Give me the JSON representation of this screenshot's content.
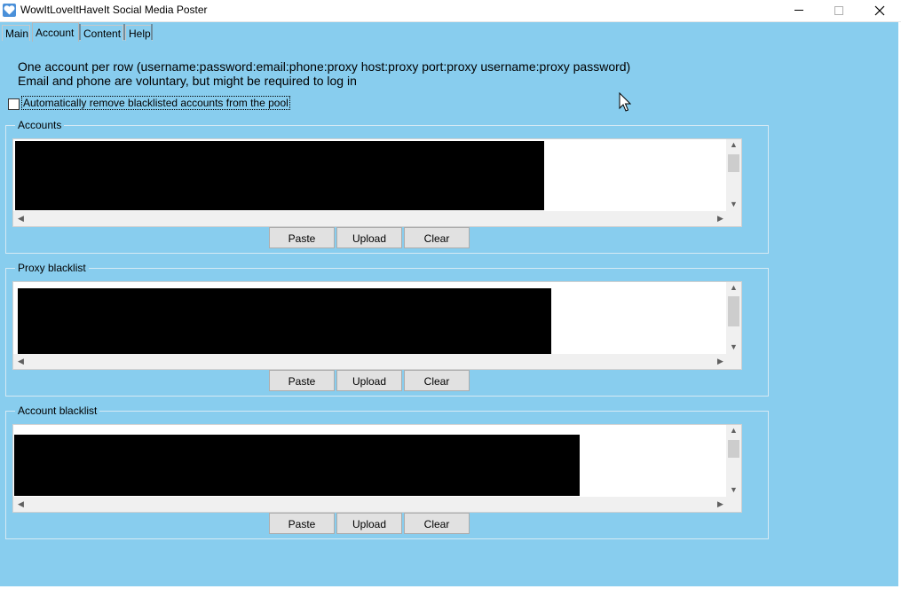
{
  "window": {
    "title": "WowItLoveItHaveIt Social Media Poster",
    "accent": "#88cdee"
  },
  "tabs": [
    {
      "label": "Main"
    },
    {
      "label": "Account"
    },
    {
      "label": "Content"
    },
    {
      "label": "Help"
    }
  ],
  "active_tab": "Account",
  "description": {
    "line1": "One account per row (username:password:email:phone:proxy host:proxy port:proxy username:proxy password)",
    "line2": "Email and phone are voluntary, but might be required to log in"
  },
  "auto_remove": {
    "label": "Automatically remove blacklisted accounts from the pool",
    "checked": false
  },
  "groups": [
    {
      "title": "Accounts",
      "buttons": {
        "paste": "Paste",
        "upload": "Upload",
        "clear": "Clear"
      }
    },
    {
      "title": "Proxy blacklist",
      "buttons": {
        "paste": "Paste",
        "upload": "Upload",
        "clear": "Clear"
      }
    },
    {
      "title": "Account blacklist",
      "buttons": {
        "paste": "Paste",
        "upload": "Upload",
        "clear": "Clear"
      }
    }
  ],
  "icons": {
    "app": "heart-icon",
    "minimize": "minimize-icon",
    "maximize": "maximize-icon",
    "close": "close-icon"
  }
}
